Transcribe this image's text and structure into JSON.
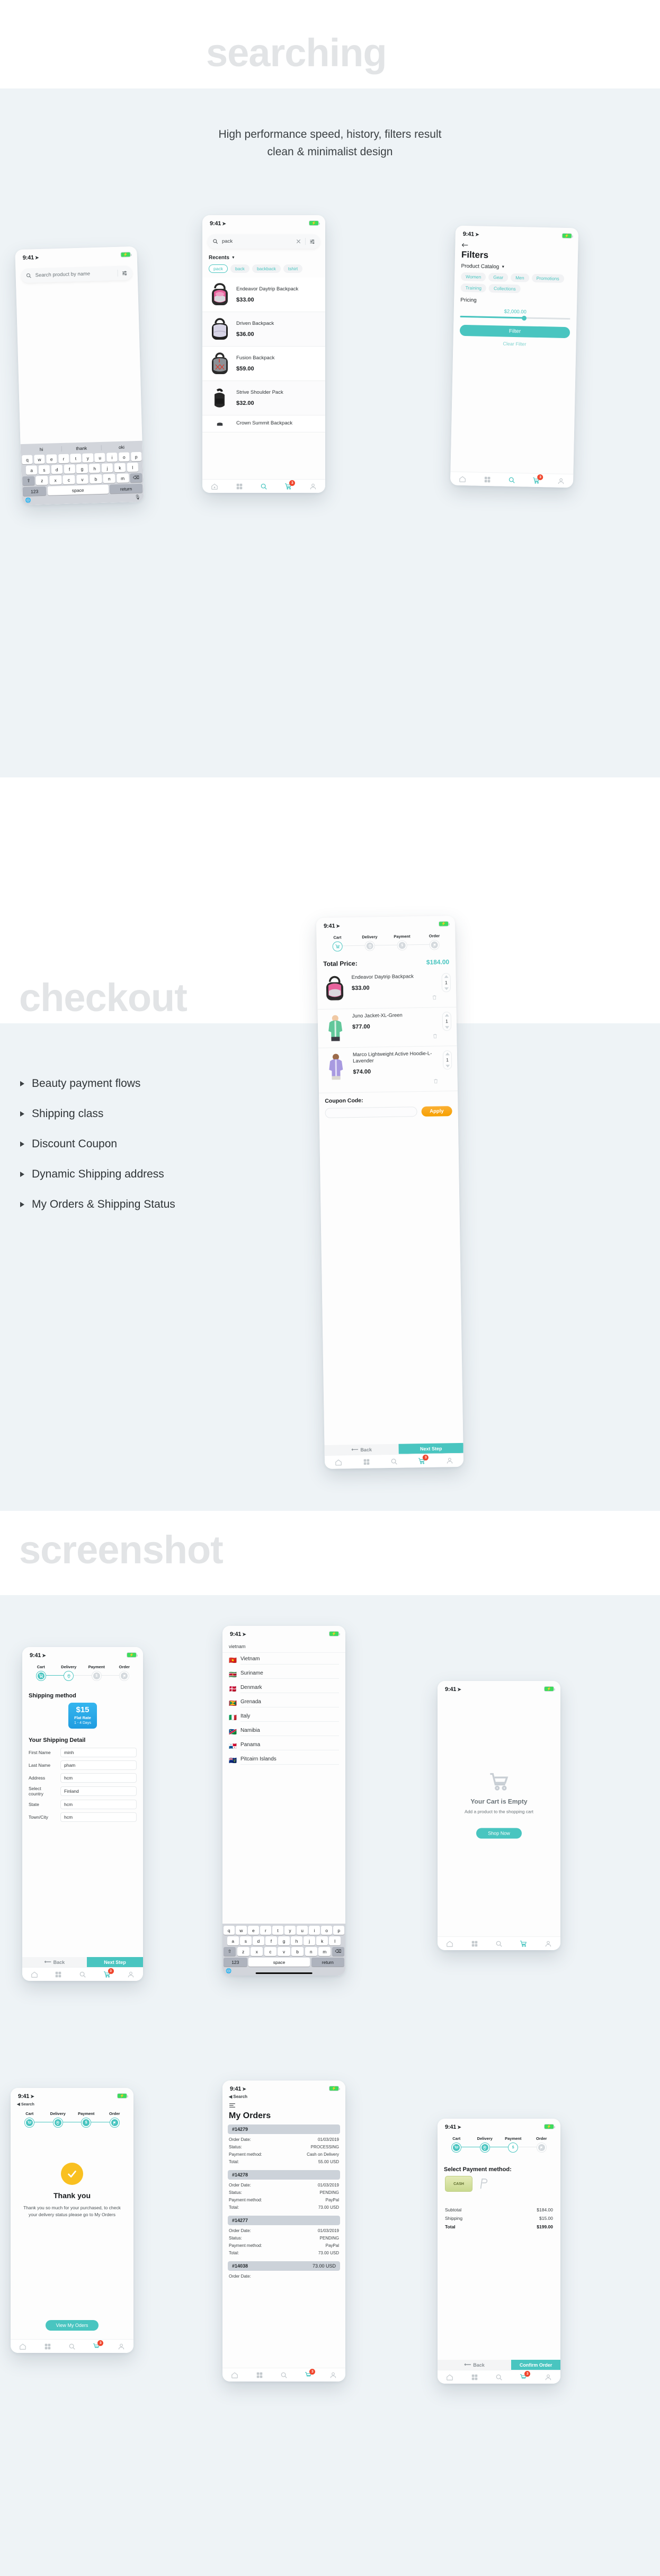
{
  "sections": {
    "searching": {
      "title": "searching",
      "subtitle_line1": "High performance speed, history, filters result",
      "subtitle_line2": "clean & minimalist design"
    },
    "checkout": {
      "title": "checkout",
      "features": [
        "Beauty payment flows",
        "Shipping class",
        "Discount Coupon",
        "Dynamic Shipping address",
        "My Orders & Shipping Status"
      ]
    },
    "screenshot": {
      "title": "screenshot"
    }
  },
  "colors": {
    "accent": "#49c5c0",
    "badge": "#f0462d",
    "apply": "#f6a000",
    "ghost_title": "#e2e4e6",
    "band": "#eef3f6",
    "ship_blue": "#1f9ce0",
    "check_yellow": "#f9c020"
  },
  "status_bar": {
    "time": "9:41",
    "location_icon": "location-arrow-icon",
    "battery_icon": "battery-charging-icon"
  },
  "tabbar": {
    "items": [
      "home-icon",
      "grid-icon",
      "search-icon",
      "cart-icon",
      "person-icon"
    ],
    "cart_badge": "3"
  },
  "phone_search_empty": {
    "search_placeholder": "Search product by name",
    "search_icon": "search-icon",
    "filter_icon": "sliders-icon",
    "keyboard": {
      "predictions": [
        "hi",
        "thank",
        "oki"
      ],
      "row1": [
        "q",
        "w",
        "e",
        "r",
        "t",
        "y",
        "u",
        "i",
        "o",
        "p"
      ],
      "row2": [
        "a",
        "s",
        "d",
        "f",
        "g",
        "h",
        "j",
        "k",
        "l"
      ],
      "row3": [
        "z",
        "x",
        "c",
        "v",
        "b",
        "n",
        "m"
      ],
      "shift_key": "shift-icon",
      "backspace_key": "backspace-icon",
      "num_key": "123",
      "space_key": "space",
      "return_key": "return",
      "globe_key": "globe-icon",
      "mic_key": "mic-icon"
    }
  },
  "phone_search_results": {
    "search_value": "pack",
    "search_icon": "search-icon",
    "clear_icon": "close-icon",
    "filter_icon": "sliders-icon",
    "recents_label": "Recents",
    "recents_caret": "chevron-down-icon",
    "recent_chips": [
      "pack",
      "back",
      "backback",
      "tshirt"
    ],
    "active_chip": "pack",
    "results": [
      {
        "name": "Endeavor Daytrip Backpack",
        "price": "$33.00",
        "img": "backpack-pink"
      },
      {
        "name": "Driven Backpack",
        "price": "$36.00",
        "img": "backpack-lavender"
      },
      {
        "name": "Fusion Backpack",
        "price": "$59.00",
        "img": "backpack-gray"
      },
      {
        "name": "Strive Shoulder Pack",
        "price": "$32.00",
        "img": "backpack-black"
      },
      {
        "name": "Crown Summit Backpack",
        "price": "",
        "img": "backpack-dark"
      }
    ]
  },
  "phone_filters": {
    "back_icon": "arrow-left-icon",
    "title": "Filters",
    "catalog_label": "Product Catalog",
    "catalog_caret": "chevron-down-icon",
    "catalog_chips": [
      "Women",
      "Gear",
      "Men",
      "Promotions",
      "Training",
      "Collections"
    ],
    "pricing_label": "Pricing",
    "pricing_value": "$2,000.00",
    "slider_percent": 58,
    "filter_button": "Filter",
    "clear_link": "Clear Filter"
  },
  "phone_cart": {
    "steps": [
      {
        "label": "Cart",
        "icon": "cart-icon",
        "state": "current"
      },
      {
        "label": "Delivery",
        "icon": "pin-icon",
        "state": "todo"
      },
      {
        "label": "Payment",
        "icon": "dollar-icon",
        "state": "todo"
      },
      {
        "label": "Order",
        "icon": "flag-icon",
        "state": "todo"
      }
    ],
    "total_label": "Total Price:",
    "total_value": "$184.00",
    "items": [
      {
        "name": "Endeavor Daytrip Backpack",
        "price": "$33.00",
        "qty": "1",
        "img": "backpack-pink"
      },
      {
        "name": "Juno Jacket-XL-Green",
        "price": "$77.00",
        "qty": "1",
        "img": "jacket-green"
      },
      {
        "name": "Marco Lightweight Active Hoodie-L-Lavender",
        "price": "$74.00",
        "qty": "1",
        "img": "hoodie-lavender"
      }
    ],
    "delete_icon": "trash-icon",
    "coupon_label": "Coupon Code:",
    "coupon_value": "",
    "apply_button": "Apply",
    "back_button": "Back",
    "next_button": "Next Step"
  },
  "phone_shipping": {
    "steps": [
      {
        "label": "Cart",
        "icon": "cart-icon",
        "state": "done"
      },
      {
        "label": "Delivery",
        "icon": "pin-icon",
        "state": "current"
      },
      {
        "label": "Payment",
        "icon": "dollar-icon",
        "state": "todo"
      },
      {
        "label": "Order",
        "icon": "flag-icon",
        "state": "todo"
      }
    ],
    "method_heading": "Shipping method",
    "method_price": "$15",
    "method_name": "Flat Rate",
    "method_days": "1 - 4 Days",
    "detail_heading": "Your Shipping Detail",
    "fields": [
      {
        "label": "First Name",
        "value": "minh"
      },
      {
        "label": "Last Name",
        "value": "pham"
      },
      {
        "label": "Address",
        "value": "hcm"
      },
      {
        "label": "Select country",
        "value": "Finland"
      },
      {
        "label": "State",
        "value": "hcm"
      },
      {
        "label": "Town/City",
        "value": "hcm"
      }
    ],
    "back_button": "Back",
    "next_button": "Next Step"
  },
  "phone_country": {
    "search_value": "vietnam",
    "countries": [
      {
        "name": "Vietnam",
        "flag": "🇻🇳"
      },
      {
        "name": "Suriname",
        "flag": "🇸🇷"
      },
      {
        "name": "Denmark",
        "flag": "🇩🇰"
      },
      {
        "name": "Grenada",
        "flag": "🇬🇩"
      },
      {
        "name": "Italy",
        "flag": "🇮🇹"
      },
      {
        "name": "Namibia",
        "flag": "🇳🇦"
      },
      {
        "name": "Panama",
        "flag": "🇵🇦"
      },
      {
        "name": "Pitcairn Islands",
        "flag": "🇵🇳"
      }
    ],
    "keyboard": {
      "row1": [
        "q",
        "w",
        "e",
        "r",
        "t",
        "y",
        "u",
        "i",
        "o",
        "p"
      ],
      "row2": [
        "a",
        "s",
        "d",
        "f",
        "g",
        "h",
        "j",
        "k",
        "l"
      ],
      "row3": [
        "z",
        "x",
        "c",
        "v",
        "b",
        "n",
        "m"
      ],
      "num_key": "123",
      "space_key": "space",
      "return_key": "return",
      "globe_key": "globe-icon"
    }
  },
  "phone_empty_cart": {
    "cart_icon": "cart-outline-icon",
    "title": "Your Cart is Empty",
    "subtitle": "Add a product to the shopping cart",
    "button": "Shop Now"
  },
  "phone_thankyou": {
    "steps": [
      {
        "label": "Cart",
        "icon": "cart-icon",
        "state": "done"
      },
      {
        "label": "Delivery",
        "icon": "pin-icon",
        "state": "done"
      },
      {
        "label": "Payment",
        "icon": "dollar-icon",
        "state": "done"
      },
      {
        "label": "Order",
        "icon": "flag-icon",
        "state": "done"
      }
    ],
    "back_label": "Search",
    "check_icon": "check-icon",
    "title": "Thank you",
    "body": "Thank you so much for your purchased, to check your delivery status please go to My Orders",
    "button": "View My Oders"
  },
  "phone_orders": {
    "back_label": "Search",
    "menu_icon": "menu-icon",
    "title": "My Orders",
    "labels": {
      "date": "Order Date:",
      "status": "Status:",
      "payment": "Payment method:",
      "total": "Total:"
    },
    "orders": [
      {
        "id": "#14279",
        "date": "01/03/2019",
        "status": "PROCESSING",
        "payment": "Cash on Delivery",
        "total": "55.00 USD"
      },
      {
        "id": "#14278",
        "date": "01/03/2019",
        "status": "PENDING",
        "payment": "PayPal",
        "total": "73.00 USD"
      },
      {
        "id": "#14277",
        "date": "01/03/2019",
        "status": "PENDING",
        "payment": "PayPal",
        "total": "73.00 USD"
      },
      {
        "id": "#14038",
        "date": "",
        "status": "",
        "payment": "",
        "total": "73.00 USD"
      }
    ]
  },
  "phone_payment": {
    "steps": [
      {
        "label": "Cart",
        "icon": "cart-icon",
        "state": "done"
      },
      {
        "label": "Delivery",
        "icon": "pin-icon",
        "state": "done"
      },
      {
        "label": "Payment",
        "icon": "dollar-icon",
        "state": "current"
      },
      {
        "label": "Order",
        "icon": "flag-icon",
        "state": "todo"
      }
    ],
    "heading": "Select Payment method:",
    "method_label": "CASH",
    "alt_icon": "paypal-icon",
    "summary": [
      {
        "label": "Subtotal",
        "value": "$184.00"
      },
      {
        "label": "Shipping",
        "value": "$15.00"
      },
      {
        "label": "Total",
        "value": "$199.00"
      }
    ],
    "back_button": "Back",
    "confirm_button": "Confirm Order"
  }
}
